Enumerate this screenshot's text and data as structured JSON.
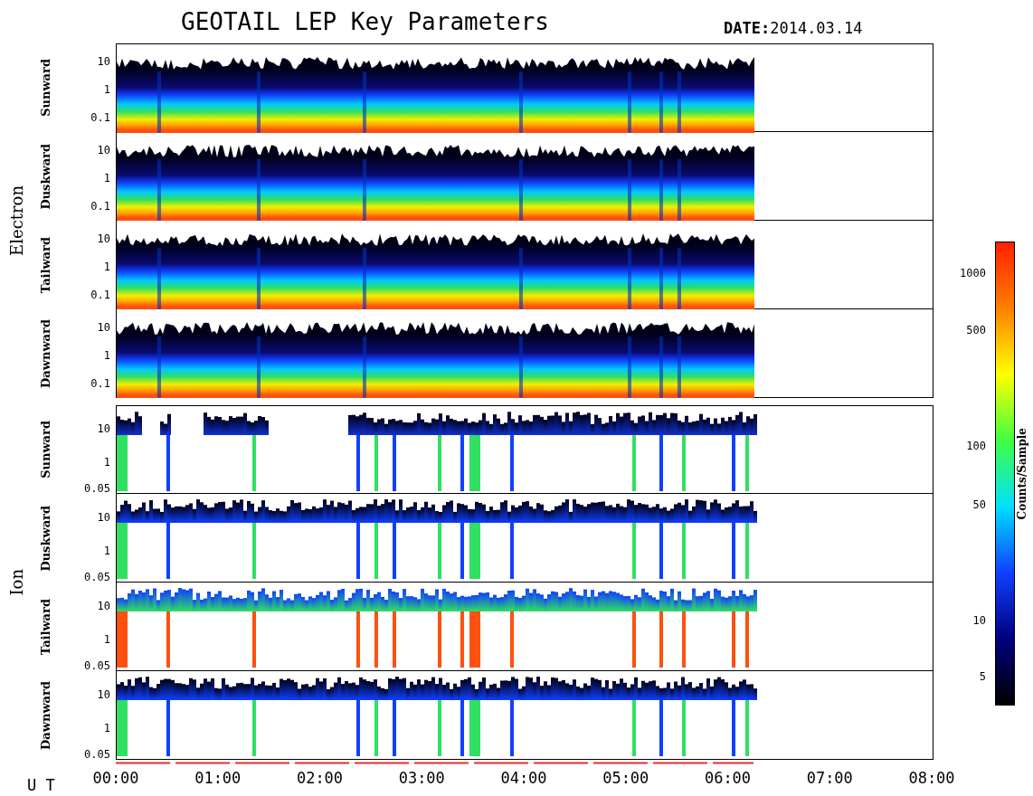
{
  "title": "GEOTAIL LEP Key Parameters",
  "date": "**DATE:**2014.03.14",
  "groups": [
    {
      "label": "Electron",
      "kind": "electron",
      "panels": [
        {
          "label": "Sunward",
          "yticks": [
            "10",
            "1",
            "0.1"
          ]
        },
        {
          "label": "Duskward",
          "yticks": [
            "10",
            "1",
            "0.1"
          ]
        },
        {
          "label": "Tailward",
          "yticks": [
            "10",
            "1",
            "0.1"
          ]
        },
        {
          "label": "Dawnward",
          "yticks": [
            "10",
            "1",
            "0.1"
          ]
        }
      ]
    },
    {
      "label": "Ion",
      "kind": "ion",
      "panels": [
        {
          "label": "Sunward",
          "yticks": [
            "10",
            "1",
            "0.05"
          ]
        },
        {
          "label": "Duskward",
          "yticks": [
            "10",
            "1",
            "0.05"
          ]
        },
        {
          "label": "Tailward",
          "yticks": [
            "10",
            "1",
            "0.05"
          ]
        },
        {
          "label": "Dawnward",
          "yticks": [
            "10",
            "1",
            "0.05"
          ]
        }
      ]
    }
  ],
  "x_axis": {
    "label": "U T",
    "ticks": [
      "00:00",
      "01:00",
      "02:00",
      "03:00",
      "04:00",
      "05:00",
      "06:00",
      "07:00",
      "08:00"
    ]
  },
  "colorbar": {
    "label": "Counts/Sample",
    "ticks": [
      "1000",
      "500",
      "100",
      "50",
      "10",
      "5"
    ]
  }
}
